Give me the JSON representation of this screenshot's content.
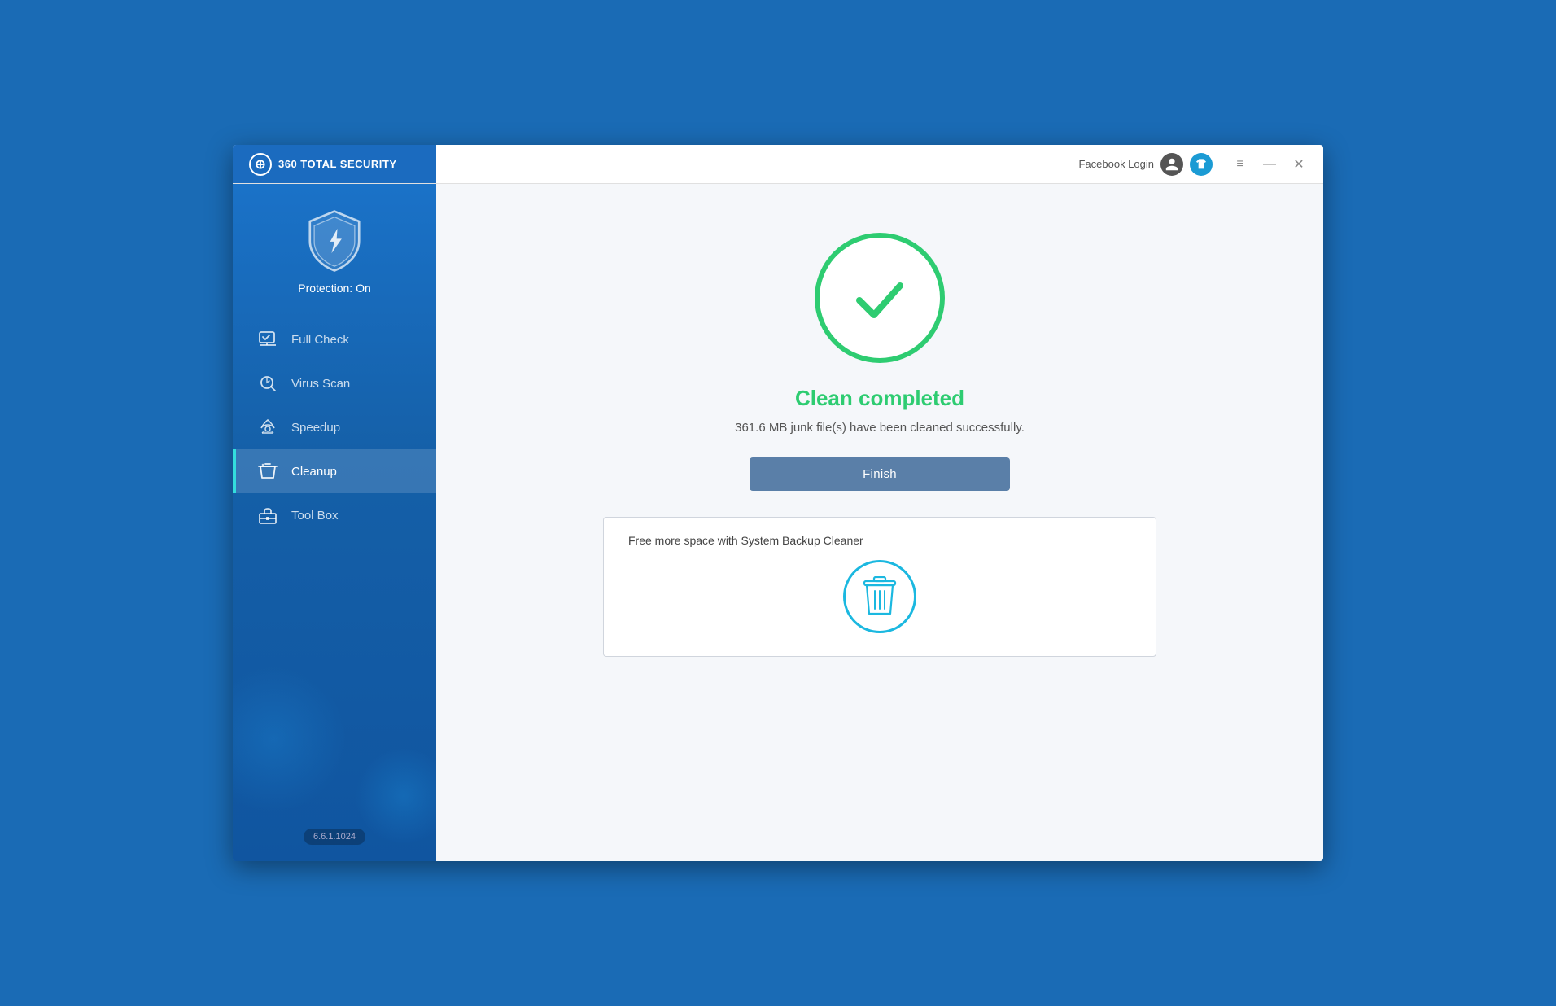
{
  "app": {
    "title": "360 TOTAL SECURITY",
    "version": "6.6.1.1024"
  },
  "titlebar": {
    "facebook_login_label": "Facebook Login",
    "menu_icon": "≡",
    "minimize_icon": "—",
    "close_icon": "✕"
  },
  "sidebar": {
    "protection_label": "Protection: On",
    "nav_items": [
      {
        "id": "full-check",
        "label": "Full Check"
      },
      {
        "id": "virus-scan",
        "label": "Virus Scan"
      },
      {
        "id": "speedup",
        "label": "Speedup"
      },
      {
        "id": "cleanup",
        "label": "Cleanup",
        "active": true
      },
      {
        "id": "tool-box",
        "label": "Tool Box"
      }
    ],
    "version": "6.6.1.1024"
  },
  "main": {
    "clean_title": "Clean completed",
    "clean_subtitle": "361.6 MB junk file(s) have been cleaned successfully.",
    "finish_button": "Finish",
    "promo_title": "Free more space with System Backup Cleaner"
  }
}
